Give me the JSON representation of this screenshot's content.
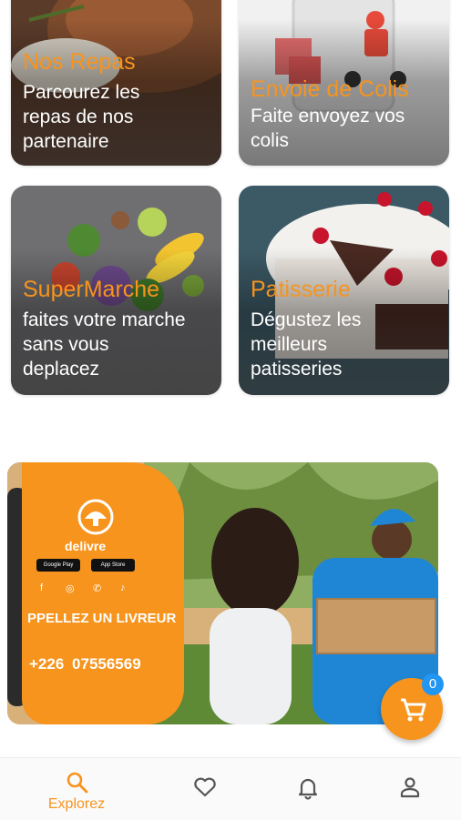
{
  "categories": [
    {
      "title": "Nos Repas",
      "desc_lines": [
        "Parcourez les",
        "repas de nos",
        "partenaire"
      ]
    },
    {
      "title": "Envoie de Colis",
      "desc_lines": [
        "Faite envoyez vos",
        "colis"
      ]
    },
    {
      "title": "SuperMarche",
      "desc_lines": [
        "faites votre marche",
        "sans vous",
        "deplacez"
      ]
    },
    {
      "title": "Patisserie",
      "desc_lines": [
        "Dégustez les",
        "meilleurs",
        "patisseries"
      ]
    }
  ],
  "banner": {
    "brand": "delivre",
    "store_badges": [
      "Google Play",
      "App Store"
    ],
    "call_text": "PPELLEZ UN LIVREUR",
    "phone_prefix": "+226",
    "phone_number": "07556569"
  },
  "cart": {
    "count": "0"
  },
  "bottom_nav": {
    "items": [
      {
        "label": "Explorez",
        "icon": "search-icon",
        "active": true
      },
      {
        "label": "",
        "icon": "heart-icon"
      },
      {
        "label": "",
        "icon": "bell-icon"
      },
      {
        "label": "",
        "icon": "person-icon"
      }
    ]
  },
  "colors": {
    "accent": "#f7941d",
    "badge": "#2196f3"
  }
}
